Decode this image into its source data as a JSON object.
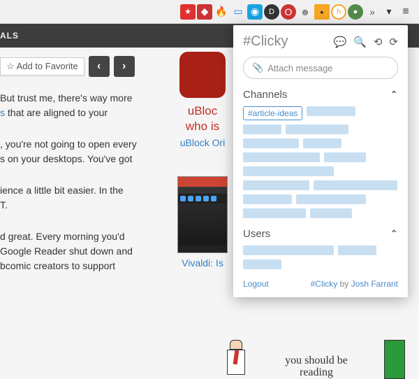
{
  "toolbar": {
    "icons": [
      "puzzle",
      "flame",
      "screen",
      "camera",
      "d",
      "opera",
      "robot",
      "block",
      "h",
      "green",
      "chevrons"
    ]
  },
  "subbar": {
    "text": "ALS"
  },
  "favorite": {
    "star": "☆",
    "label": "Add to Favorite"
  },
  "paragraphs": {
    "p1_a": "But trust me, there's way more",
    "p1_link": "s",
    "p1_b": " that are aligned to your",
    "p2_a": ", you're not going to open every",
    "p2_b": "s on your desktops. You've got",
    "p3_a": "ience a little bit easier. In the",
    "p3_b": "T.",
    "p4_a": "d great. Every morning you'd",
    "p4_b": "Google Reader shut down and",
    "p4_c": "bcomic creators to support"
  },
  "mid": {
    "ublock_a": "uBloc",
    "ublock_b": "who is",
    "ublock_link": "uBlock Ori",
    "vivaldi_link": "Vivaldi: Is"
  },
  "comic": {
    "line1": "you should be",
    "line2": "reading"
  },
  "popup": {
    "title": "#Clicky",
    "attach_placeholder": "Attach message",
    "channels_label": "Channels",
    "users_label": "Users",
    "tag": "#article-ideas",
    "logout": "Logout",
    "credit_app": "#Clicky",
    "credit_by": " by ",
    "credit_author": "Josh Farrant"
  }
}
